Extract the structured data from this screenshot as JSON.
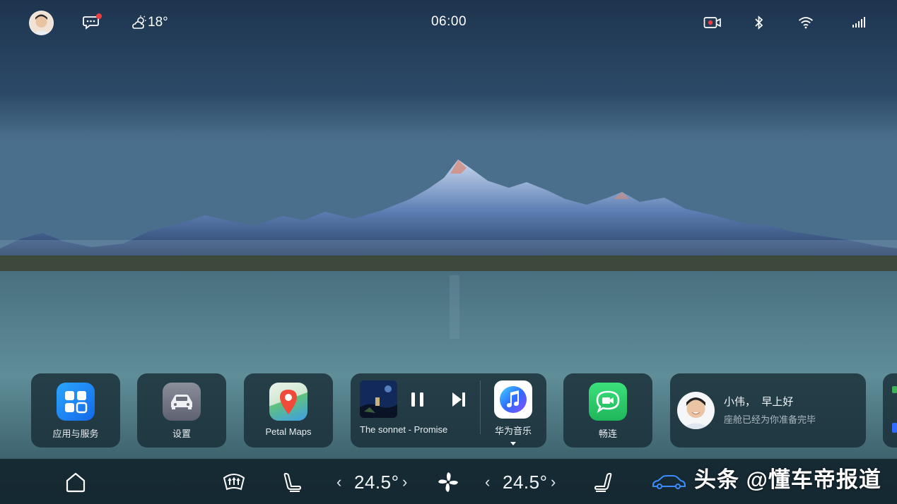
{
  "status_bar": {
    "time": "06:00",
    "weather": {
      "temp": "18°",
      "icon": "partly-cloudy-icon"
    },
    "icons": [
      "message-icon",
      "camera-record-icon",
      "bluetooth-icon",
      "wifi-icon",
      "signal-icon"
    ],
    "notification_dot_color": "#e84040"
  },
  "apps": [
    {
      "label": "应用与服务",
      "icon": "app-grid-icon"
    },
    {
      "label": "设置",
      "icon": "car-settings-icon"
    },
    {
      "label": "Petal Maps",
      "icon": "map-pin-icon"
    },
    {
      "label": "畅连",
      "icon": "video-call-icon"
    }
  ],
  "music": {
    "track": "The sonnet - Promise",
    "app_label": "华为音乐",
    "state": "playing"
  },
  "greeting": {
    "name_line": "小伟，  早上好",
    "sub_line": "座舱已经为你准备完毕"
  },
  "climate": {
    "left_temp": "24.5°",
    "right_temp": "24.5°",
    "prev_symbol": "‹",
    "next_symbol": "›"
  },
  "watermark": "头条 @懂车帝报道",
  "colors": {
    "accent_blue": "#3b8cff",
    "card_bg": "#192d37",
    "dock_bg": "#142630"
  }
}
